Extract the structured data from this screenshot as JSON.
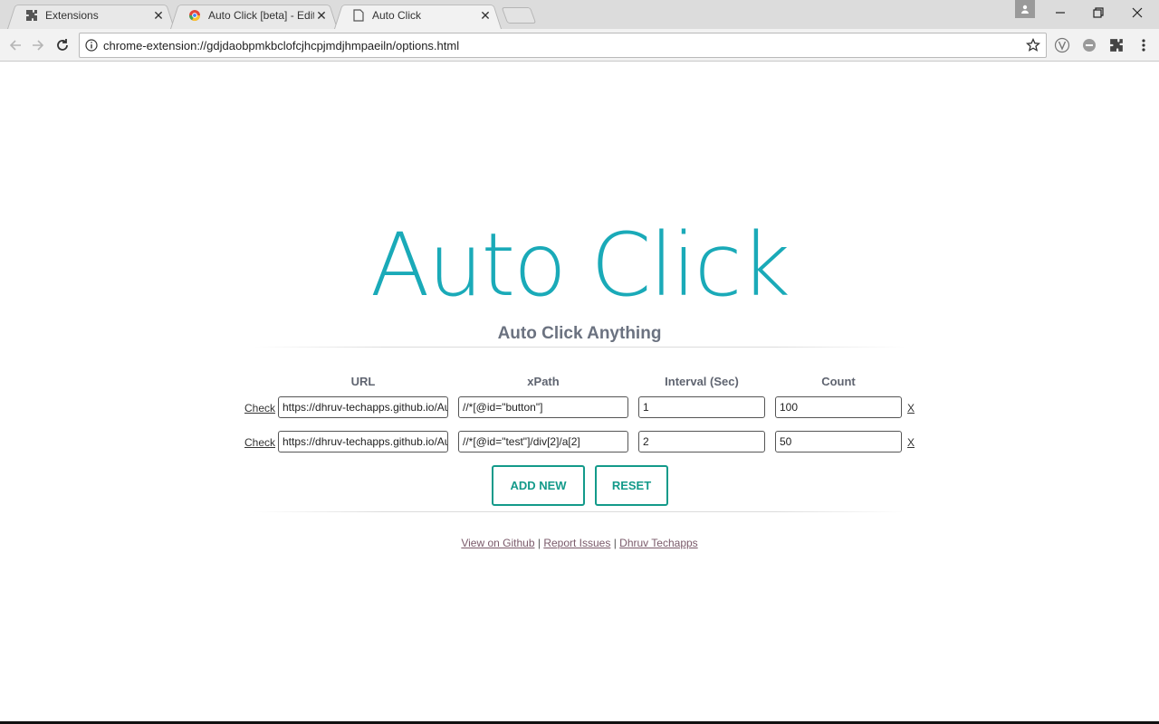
{
  "browser": {
    "tabs": [
      {
        "label": "Extensions",
        "icon": "puzzle-icon"
      },
      {
        "label": "Auto Click [beta] - Edit It",
        "icon": "chrome-icon"
      },
      {
        "label": "Auto Click",
        "icon": "page-icon"
      }
    ],
    "close_symbol": "✕",
    "url": "chrome-extension://gdjdaobpmkbclofcjhcpjmdjhmpaeiln/options.html"
  },
  "app": {
    "title": "Auto Click",
    "subtitle": "Auto Click Anything",
    "columns": {
      "url": "URL",
      "xpath": "xPath",
      "interval": "Interval (Sec)",
      "count": "Count"
    },
    "check_label": "Check",
    "remove_label": "X",
    "rows": [
      {
        "url": "https://dhruv-techapps.github.io/Auto",
        "xpath": "//*[@id=\"button\"]",
        "interval": "1",
        "count": "100"
      },
      {
        "url": "https://dhruv-techapps.github.io/Auto",
        "xpath": "//*[@id=\"test\"]/div[2]/a[2]",
        "interval": "2",
        "count": "50"
      }
    ],
    "buttons": {
      "add_new": "ADD NEW",
      "reset": "RESET"
    },
    "footer": {
      "github": "View on Github",
      "issues": "Report Issues",
      "author": "Dhruv Techapps",
      "sep": "|"
    }
  },
  "colors": {
    "accent": "#1aaab8",
    "button": "#139a8a"
  }
}
